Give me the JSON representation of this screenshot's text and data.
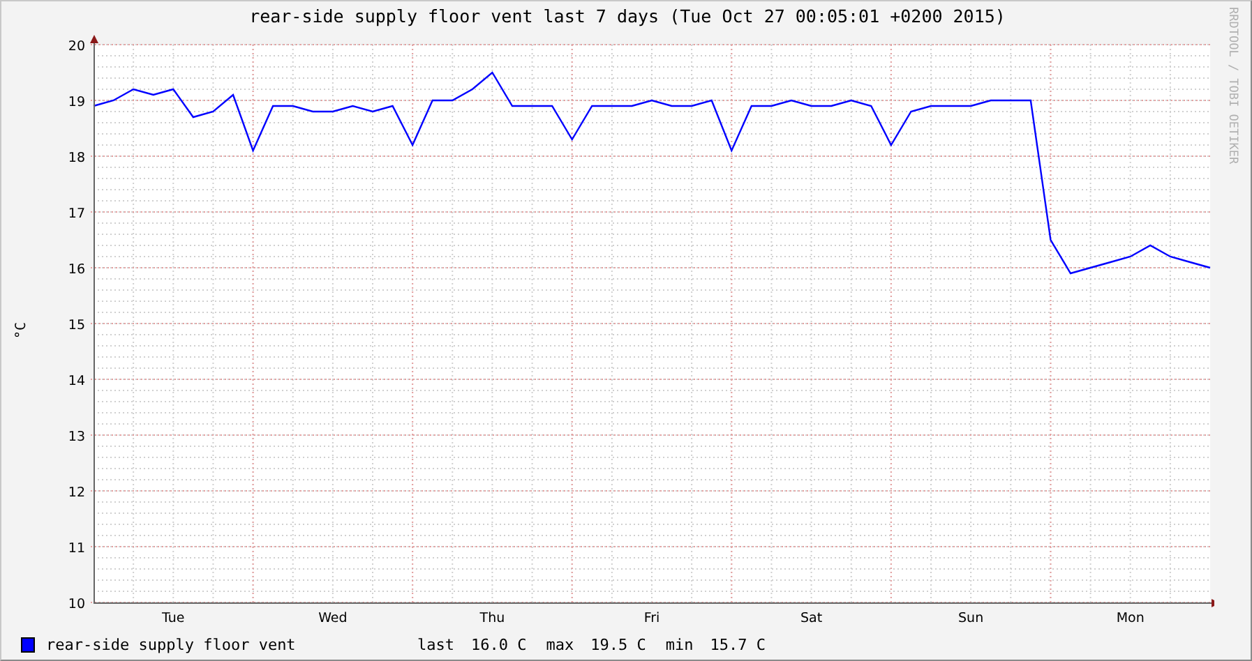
{
  "graph": {
    "credit": "RRDTOOL / TOBI OETIKER",
    "chart_data": {
      "type": "line",
      "title": "rear-side supply floor vent last 7 days (Tue Oct 27 00:05:01 +0200 2015)",
      "ylabel": "°C",
      "ylim": [
        10,
        20
      ],
      "grid": true,
      "yticks": [
        10,
        11,
        12,
        13,
        14,
        15,
        16,
        17,
        18,
        19,
        20
      ],
      "categories": [
        null,
        null,
        null,
        null,
        "Tue",
        null,
        null,
        null,
        null,
        null,
        null,
        null,
        "Wed",
        null,
        null,
        null,
        null,
        null,
        null,
        null,
        "Thu",
        null,
        null,
        null,
        null,
        null,
        null,
        null,
        "Fri",
        null,
        null,
        null,
        null,
        null,
        null,
        null,
        "Sat",
        null,
        null,
        null,
        null,
        null,
        null,
        null,
        "Sun",
        null,
        null,
        null,
        null,
        null,
        null,
        null,
        "Mon",
        null,
        null,
        null,
        null
      ],
      "series": [
        {
          "name": "rear-side supply floor vent",
          "color": "#0000ff",
          "values": [
            18.9,
            19.0,
            19.2,
            19.1,
            19.2,
            18.7,
            18.8,
            19.1,
            18.1,
            18.9,
            18.9,
            18.8,
            18.8,
            18.9,
            18.8,
            18.9,
            18.2,
            19.0,
            19.0,
            19.2,
            19.5,
            18.9,
            18.9,
            18.9,
            18.3,
            18.9,
            18.9,
            18.9,
            19.0,
            18.9,
            18.9,
            19.0,
            18.1,
            18.9,
            18.9,
            19.0,
            18.9,
            18.9,
            19.0,
            18.9,
            18.2,
            18.8,
            18.9,
            18.9,
            18.9,
            19.0,
            19.0,
            19.0,
            16.5,
            15.9,
            16.0,
            16.1,
            16.2,
            16.4,
            16.2,
            16.1,
            16.0
          ]
        }
      ]
    }
  },
  "legend": {
    "stats": [
      {
        "label": "last",
        "value": "16.0 C"
      },
      {
        "label": "max",
        "value": "19.5 C"
      },
      {
        "label": "min",
        "value": "15.7 C"
      }
    ]
  }
}
